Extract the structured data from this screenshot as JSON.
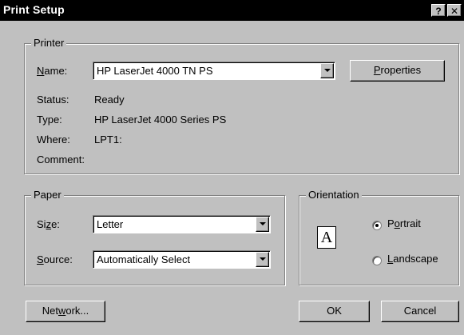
{
  "window": {
    "title": "Print Setup",
    "help_label": "?",
    "close_label": "✕"
  },
  "printer": {
    "legend": "Printer",
    "name_label_pre": "",
    "name_label_u": "N",
    "name_label_post": "ame:",
    "name_value": "HP LaserJet 4000 TN PS",
    "properties_u": "P",
    "properties_post": "roperties",
    "status_label": "Status:",
    "status_value": "Ready",
    "type_label": "Type:",
    "type_value": "HP LaserJet 4000 Series PS",
    "where_label": "Where:",
    "where_value": "LPT1:",
    "comment_label": "Comment:",
    "comment_value": ""
  },
  "paper": {
    "legend": "Paper",
    "size_label_pre": "Si",
    "size_label_u": "z",
    "size_label_post": "e:",
    "size_value": "Letter",
    "source_label_pre": "",
    "source_label_u": "S",
    "source_label_post": "ource:",
    "source_value": "Automatically Select"
  },
  "orientation": {
    "legend": "Orientation",
    "icon_letter": "A",
    "portrait_pre": "P",
    "portrait_u": "o",
    "portrait_post": "rtrait",
    "landscape_pre": "",
    "landscape_u": "L",
    "landscape_post": "andscape",
    "selected": "Portrait"
  },
  "footer": {
    "network_pre": "Net",
    "network_u": "w",
    "network_post": "ork...",
    "ok_label": "OK",
    "cancel_label": "Cancel"
  }
}
